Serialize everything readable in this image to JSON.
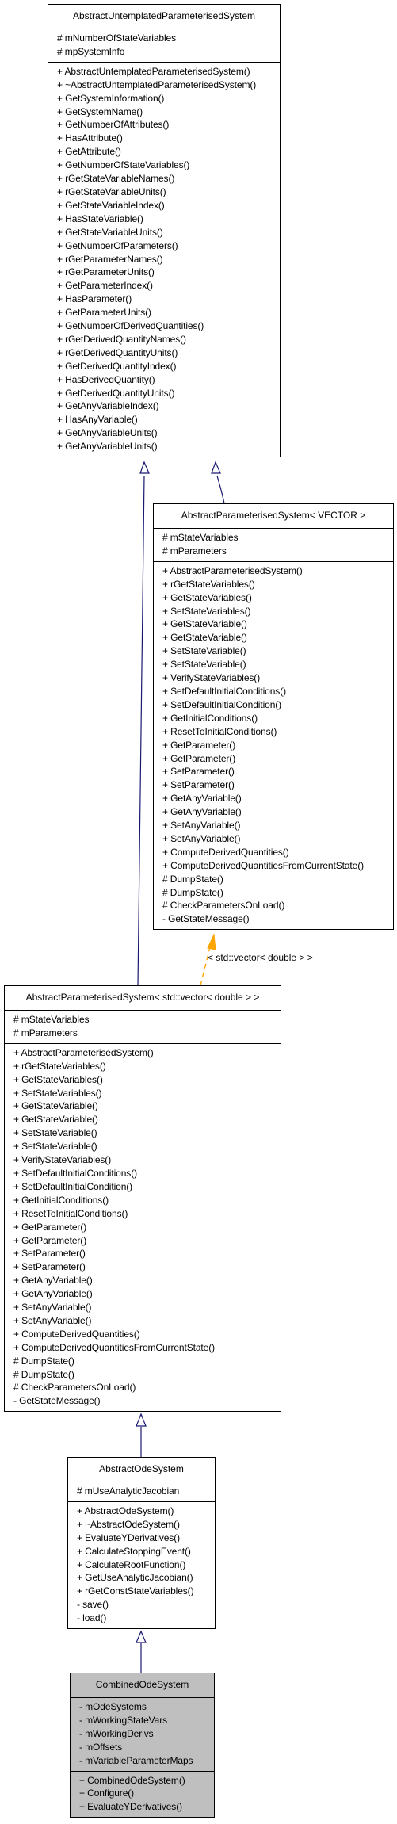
{
  "colors": {
    "inheritance": "#191970",
    "template": "#ffa500",
    "focus_fill": "#bfbfbf"
  },
  "classes": {
    "aups": {
      "name": "AbstractUntemplatedParameterisedSystem",
      "attributes": [
        "# mNumberOfStateVariables",
        "# mpSystemInfo"
      ],
      "methods": [
        "+ AbstractUntemplatedParameterisedSystem()",
        "+ ~AbstractUntemplatedParameterisedSystem()",
        "+ GetSystemInformation()",
        "+ GetSystemName()",
        "+ GetNumberOfAttributes()",
        "+ HasAttribute()",
        "+ GetAttribute()",
        "+ GetNumberOfStateVariables()",
        "+ rGetStateVariableNames()",
        "+ rGetStateVariableUnits()",
        "+ GetStateVariableIndex()",
        "+ HasStateVariable()",
        "+ GetStateVariableUnits()",
        "+ GetNumberOfParameters()",
        "+ rGetParameterNames()",
        "+ rGetParameterUnits()",
        "+ GetParameterIndex()",
        "+ HasParameter()",
        "+ GetParameterUnits()",
        "+ GetNumberOfDerivedQuantities()",
        "+ rGetDerivedQuantityNames()",
        "+ rGetDerivedQuantityUnits()",
        "+ GetDerivedQuantityIndex()",
        "+ HasDerivedQuantity()",
        "+ GetDerivedQuantityUnits()",
        "+ GetAnyVariableIndex()",
        "+ HasAnyVariable()",
        "+ GetAnyVariableUnits()",
        "+ GetAnyVariableUnits()"
      ]
    },
    "aps_vector": {
      "name": "AbstractParameterisedSystem< VECTOR >",
      "attributes": [
        "# mStateVariables",
        "# mParameters"
      ],
      "methods": [
        "+ AbstractParameterisedSystem()",
        "+ rGetStateVariables()",
        "+ GetStateVariables()",
        "+ SetStateVariables()",
        "+ GetStateVariable()",
        "+ GetStateVariable()",
        "+ SetStateVariable()",
        "+ SetStateVariable()",
        "+ VerifyStateVariables()",
        "+ SetDefaultInitialConditions()",
        "+ SetDefaultInitialCondition()",
        "+ GetInitialConditions()",
        "+ ResetToInitialConditions()",
        "+ GetParameter()",
        "+ GetParameter()",
        "+ SetParameter()",
        "+ SetParameter()",
        "+ GetAnyVariable()",
        "+ GetAnyVariable()",
        "+ SetAnyVariable()",
        "+ SetAnyVariable()",
        "+ ComputeDerivedQuantities()",
        "+ ComputeDerivedQuantitiesFromCurrentState()",
        "# DumpState()",
        "# DumpState()",
        "# CheckParametersOnLoad()",
        "- GetStateMessage()"
      ]
    },
    "aps_stdvector": {
      "name": "AbstractParameterisedSystem< std::vector< double > >",
      "attributes": [
        "# mStateVariables",
        "# mParameters"
      ],
      "methods": [
        "+ AbstractParameterisedSystem()",
        "+ rGetStateVariables()",
        "+ GetStateVariables()",
        "+ SetStateVariables()",
        "+ GetStateVariable()",
        "+ GetStateVariable()",
        "+ SetStateVariable()",
        "+ SetStateVariable()",
        "+ VerifyStateVariables()",
        "+ SetDefaultInitialConditions()",
        "+ SetDefaultInitialCondition()",
        "+ GetInitialConditions()",
        "+ ResetToInitialConditions()",
        "+ GetParameter()",
        "+ GetParameter()",
        "+ SetParameter()",
        "+ SetParameter()",
        "+ GetAnyVariable()",
        "+ GetAnyVariable()",
        "+ SetAnyVariable()",
        "+ SetAnyVariable()",
        "+ ComputeDerivedQuantities()",
        "+ ComputeDerivedQuantitiesFromCurrentState()",
        "# DumpState()",
        "# DumpState()",
        "# CheckParametersOnLoad()",
        "- GetStateMessage()"
      ]
    },
    "aode": {
      "name": "AbstractOdeSystem",
      "attributes": [
        "# mUseAnalyticJacobian"
      ],
      "methods": [
        "+ AbstractOdeSystem()",
        "+ ~AbstractOdeSystem()",
        "+ EvaluateYDerivatives()",
        "+ CalculateStoppingEvent()",
        "+ CalculateRootFunction()",
        "+ GetUseAnalyticJacobian()",
        "+ rGetConstStateVariables()",
        "- save()",
        "- load()"
      ]
    },
    "combined": {
      "name": "CombinedOdeSystem",
      "attributes": [
        "- mOdeSystems",
        "- mWorkingStateVars",
        "- mWorkingDerivs",
        "- mOffsets",
        "- mVariableParameterMaps"
      ],
      "methods": [
        "+ CombinedOdeSystem()",
        "+ Configure()",
        "+ EvaluateYDerivatives()"
      ]
    }
  },
  "edges": {
    "template_label": "< std::vector< double > >"
  }
}
